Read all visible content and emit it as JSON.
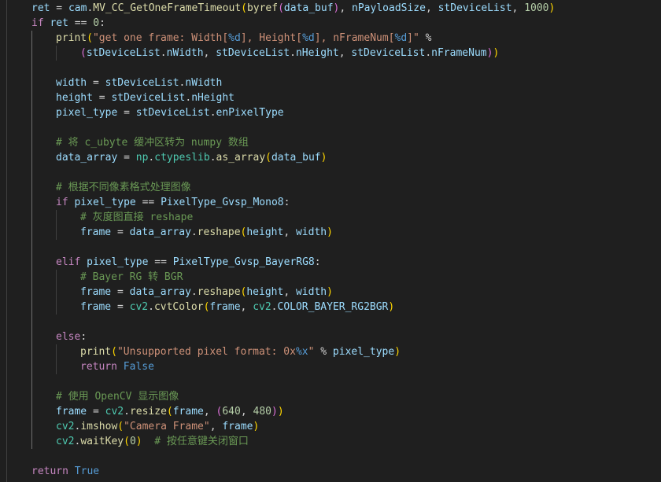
{
  "editor": {
    "language": "python",
    "theme_colors": {
      "background": "#1f1f1f",
      "keyword_control": "#c586c0",
      "keyword_const": "#569cd6",
      "function": "#dcdcaa",
      "variable": "#9cdcfe",
      "module": "#4ec9b0",
      "string": "#ce9178",
      "number": "#b5cea8",
      "comment": "#6a9955",
      "format_placeholder": "#569cd6",
      "text": "#d4d4d4",
      "bracket_1": "#ffd700",
      "bracket_2": "#da70d6",
      "bracket_3": "#179fff"
    },
    "lines": [
      {
        "indent": 0,
        "tokens": [
          [
            "ret",
            "v"
          ],
          [
            " = ",
            ""
          ],
          [
            "cam",
            "v"
          ],
          [
            ".",
            ""
          ],
          [
            "MV_CC_GetOneFrameTimeout",
            "f"
          ],
          [
            "(",
            "b1"
          ],
          [
            "byref",
            "f"
          ],
          [
            "(",
            "b2"
          ],
          [
            "data_buf",
            "v"
          ],
          [
            ")",
            "b2"
          ],
          [
            ", ",
            ""
          ],
          [
            "nPayloadSize",
            "v"
          ],
          [
            ", ",
            ""
          ],
          [
            "stDeviceList",
            "v"
          ],
          [
            ", ",
            ""
          ],
          [
            "1000",
            "n"
          ],
          [
            ")",
            "b1"
          ]
        ]
      },
      {
        "indent": 0,
        "tokens": [
          [
            "if",
            "k"
          ],
          [
            " ",
            ""
          ],
          [
            "ret",
            "v"
          ],
          [
            " == ",
            ""
          ],
          [
            "0",
            "n"
          ],
          [
            ":",
            ""
          ]
        ]
      },
      {
        "indent": 1,
        "tokens": [
          [
            "print",
            "f"
          ],
          [
            "(",
            "b1"
          ],
          [
            "\"get one frame: Width[",
            "s"
          ],
          [
            "%d",
            "p"
          ],
          [
            "], Height[",
            "s"
          ],
          [
            "%d",
            "p"
          ],
          [
            "], nFrameNum[",
            "s"
          ],
          [
            "%d",
            "p"
          ],
          [
            "]\"",
            "s"
          ],
          [
            " % ",
            ""
          ]
        ]
      },
      {
        "indent": 2,
        "tokens": [
          [
            "(",
            "b2"
          ],
          [
            "stDeviceList",
            "v"
          ],
          [
            ".",
            ""
          ],
          [
            "nWidth",
            "v"
          ],
          [
            ", ",
            ""
          ],
          [
            "stDeviceList",
            "v"
          ],
          [
            ".",
            ""
          ],
          [
            "nHeight",
            "v"
          ],
          [
            ", ",
            ""
          ],
          [
            "stDeviceList",
            "v"
          ],
          [
            ".",
            ""
          ],
          [
            "nFrameNum",
            "v"
          ],
          [
            ")",
            "b2"
          ],
          [
            ")",
            "b1"
          ]
        ]
      },
      {
        "indent": 1,
        "tokens": []
      },
      {
        "indent": 1,
        "tokens": [
          [
            "width",
            "v"
          ],
          [
            " = ",
            ""
          ],
          [
            "stDeviceList",
            "v"
          ],
          [
            ".",
            ""
          ],
          [
            "nWidth",
            "v"
          ]
        ]
      },
      {
        "indent": 1,
        "tokens": [
          [
            "height",
            "v"
          ],
          [
            " = ",
            ""
          ],
          [
            "stDeviceList",
            "v"
          ],
          [
            ".",
            ""
          ],
          [
            "nHeight",
            "v"
          ]
        ]
      },
      {
        "indent": 1,
        "tokens": [
          [
            "pixel_type",
            "v"
          ],
          [
            " = ",
            ""
          ],
          [
            "stDeviceList",
            "v"
          ],
          [
            ".",
            ""
          ],
          [
            "enPixelType",
            "v"
          ]
        ]
      },
      {
        "indent": 1,
        "tokens": []
      },
      {
        "indent": 1,
        "tokens": [
          [
            "# 将 c_ubyte 缓冲区转为 numpy 数组",
            "c"
          ]
        ]
      },
      {
        "indent": 1,
        "tokens": [
          [
            "data_array",
            "v"
          ],
          [
            " = ",
            ""
          ],
          [
            "np",
            "m"
          ],
          [
            ".",
            ""
          ],
          [
            "ctypeslib",
            "m"
          ],
          [
            ".",
            ""
          ],
          [
            "as_array",
            "f"
          ],
          [
            "(",
            "b1"
          ],
          [
            "data_buf",
            "v"
          ],
          [
            ")",
            "b1"
          ]
        ]
      },
      {
        "indent": 1,
        "tokens": []
      },
      {
        "indent": 1,
        "tokens": [
          [
            "# 根据不同像素格式处理图像",
            "c"
          ]
        ]
      },
      {
        "indent": 1,
        "tokens": [
          [
            "if",
            "k"
          ],
          [
            " ",
            ""
          ],
          [
            "pixel_type",
            "v"
          ],
          [
            " == ",
            ""
          ],
          [
            "PixelType_Gvsp_Mono8",
            "v"
          ],
          [
            ":",
            ""
          ]
        ]
      },
      {
        "indent": 2,
        "tokens": [
          [
            "# 灰度图直接 reshape",
            "c"
          ]
        ]
      },
      {
        "indent": 2,
        "tokens": [
          [
            "frame",
            "v"
          ],
          [
            " = ",
            ""
          ],
          [
            "data_array",
            "v"
          ],
          [
            ".",
            ""
          ],
          [
            "reshape",
            "f"
          ],
          [
            "(",
            "b1"
          ],
          [
            "height",
            "v"
          ],
          [
            ", ",
            ""
          ],
          [
            "width",
            "v"
          ],
          [
            ")",
            "b1"
          ]
        ]
      },
      {
        "indent": 1,
        "tokens": []
      },
      {
        "indent": 1,
        "tokens": [
          [
            "elif",
            "k"
          ],
          [
            " ",
            ""
          ],
          [
            "pixel_type",
            "v"
          ],
          [
            " == ",
            ""
          ],
          [
            "PixelType_Gvsp_BayerRG8",
            "v"
          ],
          [
            ":",
            ""
          ]
        ]
      },
      {
        "indent": 2,
        "tokens": [
          [
            "# Bayer RG 转 BGR",
            "c"
          ]
        ]
      },
      {
        "indent": 2,
        "tokens": [
          [
            "frame",
            "v"
          ],
          [
            " = ",
            ""
          ],
          [
            "data_array",
            "v"
          ],
          [
            ".",
            ""
          ],
          [
            "reshape",
            "f"
          ],
          [
            "(",
            "b1"
          ],
          [
            "height",
            "v"
          ],
          [
            ", ",
            ""
          ],
          [
            "width",
            "v"
          ],
          [
            ")",
            "b1"
          ]
        ]
      },
      {
        "indent": 2,
        "tokens": [
          [
            "frame",
            "v"
          ],
          [
            " = ",
            ""
          ],
          [
            "cv2",
            "m"
          ],
          [
            ".",
            ""
          ],
          [
            "cvtColor",
            "f"
          ],
          [
            "(",
            "b1"
          ],
          [
            "frame",
            "v"
          ],
          [
            ", ",
            ""
          ],
          [
            "cv2",
            "m"
          ],
          [
            ".",
            ""
          ],
          [
            "COLOR_BAYER_RG2BGR",
            "v"
          ],
          [
            ")",
            "b1"
          ]
        ]
      },
      {
        "indent": 1,
        "tokens": []
      },
      {
        "indent": 1,
        "tokens": [
          [
            "else",
            "k"
          ],
          [
            ":",
            ""
          ]
        ]
      },
      {
        "indent": 2,
        "tokens": [
          [
            "print",
            "f"
          ],
          [
            "(",
            "b1"
          ],
          [
            "\"Unsupported pixel format: 0x",
            "s"
          ],
          [
            "%x",
            "p"
          ],
          [
            "\"",
            "s"
          ],
          [
            " % ",
            ""
          ],
          [
            "pixel_type",
            "v"
          ],
          [
            ")",
            "b1"
          ]
        ]
      },
      {
        "indent": 2,
        "tokens": [
          [
            "return",
            "k"
          ],
          [
            " ",
            ""
          ],
          [
            "False",
            "kc"
          ]
        ]
      },
      {
        "indent": 1,
        "tokens": []
      },
      {
        "indent": 1,
        "tokens": [
          [
            "# 使用 OpenCV 显示图像",
            "c"
          ]
        ]
      },
      {
        "indent": 1,
        "tokens": [
          [
            "frame",
            "v"
          ],
          [
            " = ",
            ""
          ],
          [
            "cv2",
            "m"
          ],
          [
            ".",
            ""
          ],
          [
            "resize",
            "f"
          ],
          [
            "(",
            "b1"
          ],
          [
            "frame",
            "v"
          ],
          [
            ", ",
            ""
          ],
          [
            "(",
            "b2"
          ],
          [
            "640",
            "n"
          ],
          [
            ", ",
            ""
          ],
          [
            "480",
            "n"
          ],
          [
            ")",
            "b2"
          ],
          [
            ")",
            "b1"
          ]
        ]
      },
      {
        "indent": 1,
        "tokens": [
          [
            "cv2",
            "m"
          ],
          [
            ".",
            ""
          ],
          [
            "imshow",
            "f"
          ],
          [
            "(",
            "b1"
          ],
          [
            "\"Camera Frame\"",
            "s"
          ],
          [
            ", ",
            ""
          ],
          [
            "frame",
            "v"
          ],
          [
            ")",
            "b1"
          ]
        ]
      },
      {
        "indent": 1,
        "tokens": [
          [
            "cv2",
            "m"
          ],
          [
            ".",
            ""
          ],
          [
            "waitKey",
            "f"
          ],
          [
            "(",
            "b1"
          ],
          [
            "0",
            "n"
          ],
          [
            ")",
            "b1"
          ],
          [
            "  ",
            ""
          ],
          [
            "# 按任意键关闭窗口",
            "c"
          ]
        ]
      },
      {
        "indent": 0,
        "tokens": []
      },
      {
        "indent": 0,
        "tokens": [
          [
            "return",
            "k"
          ],
          [
            " ",
            ""
          ],
          [
            "True",
            "kc"
          ]
        ]
      }
    ]
  }
}
